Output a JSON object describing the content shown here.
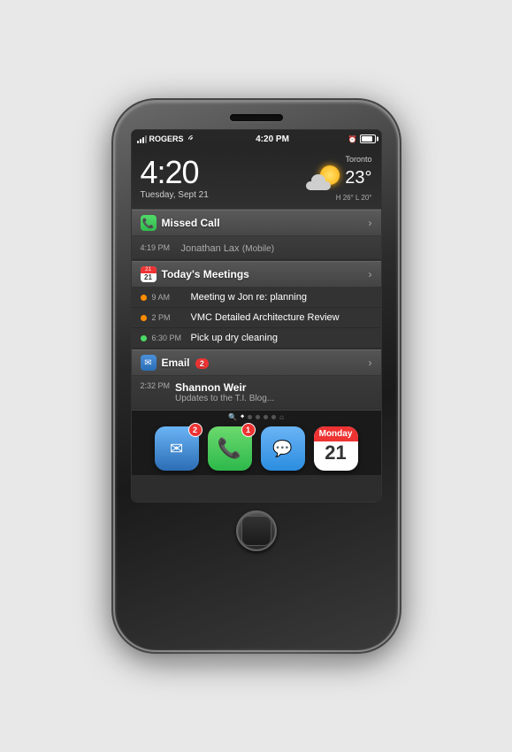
{
  "phone": {
    "speaker_label": "speaker"
  },
  "status_bar": {
    "carrier": "ROGERS",
    "time": "4:20 PM",
    "signal_label": "signal"
  },
  "clock_widget": {
    "time": "4:20",
    "date": "Tuesday, Sept 21",
    "city": "Toronto",
    "temp": "23°",
    "hi_lo": "H 26°  L 20°"
  },
  "missed_call": {
    "header": "Missed Call",
    "time": "4:19 PM",
    "caller": "Jonathan Lax",
    "caller_type": "(Mobile)"
  },
  "meetings": {
    "header": "Today's Meetings",
    "date_num": "21",
    "items": [
      {
        "time": "9 AM",
        "title": "Meeting w Jon re: planning",
        "dot": "orange"
      },
      {
        "time": "2 PM",
        "title": "VMC Detailed Architecture Review",
        "dot": "orange"
      },
      {
        "time": "6:30 PM",
        "title": "Pick up dry cleaning",
        "dot": "green"
      }
    ]
  },
  "email": {
    "header": "Email",
    "badge": "2",
    "time": "2:32 PM",
    "sender": "Shannon Weir",
    "preview": "Updates to the T.I. Blog..."
  },
  "dock": {
    "apps": [
      {
        "name": "Mail",
        "badge": "2",
        "type": "mail"
      },
      {
        "name": "Phone",
        "badge": "1",
        "type": "phone"
      },
      {
        "name": "Messages",
        "badge": null,
        "type": "messages"
      },
      {
        "name": "Calendar",
        "badge": null,
        "type": "calendar",
        "day_name": "Monday",
        "day_num": "21"
      }
    ]
  }
}
